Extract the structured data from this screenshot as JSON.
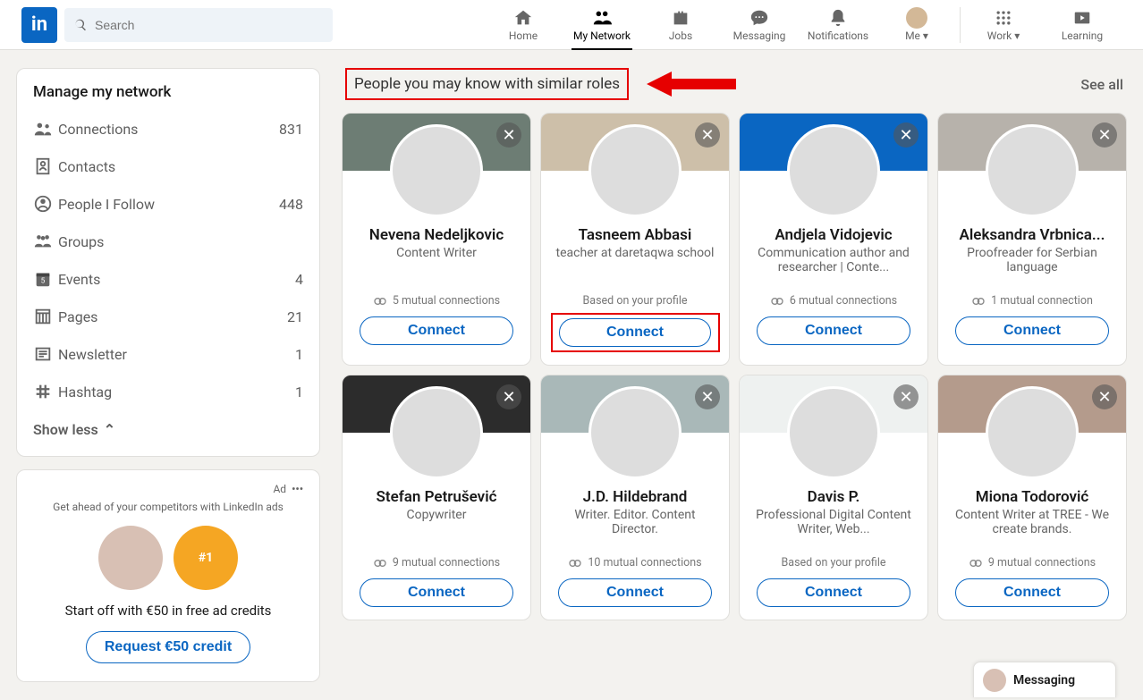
{
  "search": {
    "placeholder": "Search"
  },
  "nav": {
    "home": "Home",
    "network": "My Network",
    "jobs": "Jobs",
    "messaging": "Messaging",
    "notifications": "Notifications",
    "me": "Me",
    "work": "Work",
    "learning": "Learning"
  },
  "sidebar": {
    "title": "Manage my network",
    "items": [
      {
        "label": "Connections",
        "count": "831"
      },
      {
        "label": "Contacts",
        "count": ""
      },
      {
        "label": "People I Follow",
        "count": "448"
      },
      {
        "label": "Groups",
        "count": ""
      },
      {
        "label": "Events",
        "count": "4"
      },
      {
        "label": "Pages",
        "count": "21"
      },
      {
        "label": "Newsletter",
        "count": "1"
      },
      {
        "label": "Hashtag",
        "count": "1"
      }
    ],
    "showless": "Show less"
  },
  "ad": {
    "tag": "Ad",
    "line1": "Get ahead of your competitors with LinkedIn ads",
    "trophy": "#1",
    "text": "Start off with €50 in free ad credits",
    "button": "Request €50 credit"
  },
  "section": {
    "title": "People you may know with similar roles",
    "seeall": "See all",
    "connect": "Connect"
  },
  "people": [
    {
      "name": "Nevena Nedeljkovic",
      "role": "Content Writer",
      "mutual": "5 mutual connections",
      "mutual_type": "mutual"
    },
    {
      "name": "Tasneem Abbasi",
      "role": "teacher at daretaqwa school",
      "mutual": "Based on your profile",
      "mutual_type": "profile"
    },
    {
      "name": "Andjela Vidojevic",
      "role": "Communication author and researcher | Conte...",
      "mutual": "6 mutual connections",
      "mutual_type": "mutual"
    },
    {
      "name": "Aleksandra Vrbnica...",
      "role": "Proofreader for Serbian language",
      "mutual": "1 mutual connection",
      "mutual_type": "mutual"
    },
    {
      "name": "Stefan Petrušević",
      "role": "Copywriter",
      "mutual": "9 mutual connections",
      "mutual_type": "mutual"
    },
    {
      "name": "J.D. Hildebrand",
      "role": "Writer. Editor. Content Director.",
      "mutual": "10 mutual connections",
      "mutual_type": "mutual"
    },
    {
      "name": "Davis P.",
      "role": "Professional Digital Content Writer, Web...",
      "mutual": "Based on your profile",
      "mutual_type": "profile"
    },
    {
      "name": "Miona Todorović",
      "role": "Content Writer at TREE - We create brands.",
      "mutual": "9 mutual connections",
      "mutual_type": "mutual"
    }
  ],
  "messaging_pill": "Messaging"
}
